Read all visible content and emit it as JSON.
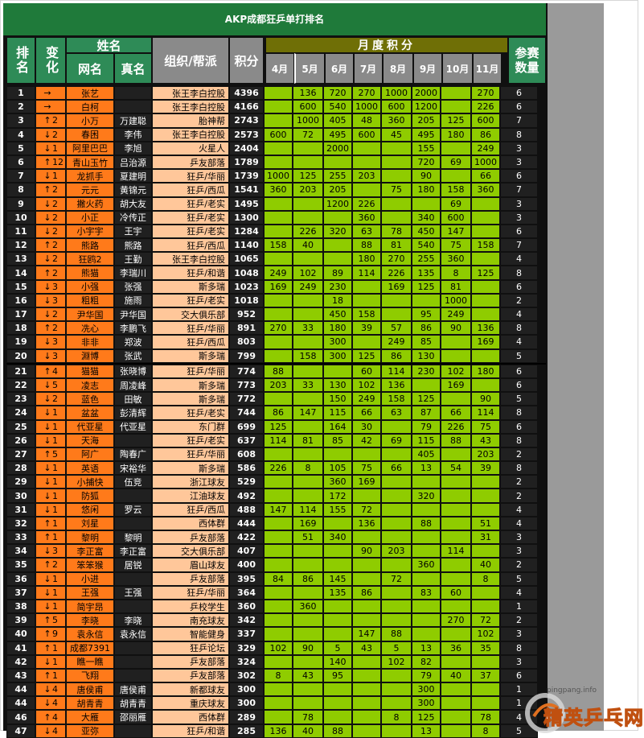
{
  "title": "AKP成都狂乒单打排名",
  "headers": {
    "rank": "排名",
    "change": "变化",
    "name_group": "姓名",
    "netname": "网名",
    "realname": "真名",
    "org": "组织/帮派",
    "score": "积分",
    "monthly": "月度积分",
    "months": [
      "4月",
      "5月",
      "6月",
      "7月",
      "8月",
      "9月",
      "10月",
      "11月"
    ],
    "count": "参赛数量"
  },
  "rows": [
    {
      "rank": "1",
      "dir": "→",
      "chg": "",
      "net": "张艺",
      "real": "",
      "org": "张王李白控股",
      "score": "4396",
      "m": [
        "",
        "136",
        "720",
        "270",
        "1000",
        "2000",
        "",
        "270"
      ],
      "cnt": "6"
    },
    {
      "rank": "2",
      "dir": "→",
      "chg": "",
      "net": "白柯",
      "real": "",
      "org": "张王李白控股",
      "score": "4166",
      "m": [
        "",
        "600",
        "540",
        "1000",
        "600",
        "1200",
        "",
        "226"
      ],
      "cnt": "6"
    },
    {
      "rank": "3",
      "dir": "↑",
      "chg": "2",
      "net": "小万",
      "real": "万建聪",
      "org": "胎神帮",
      "score": "2743",
      "m": [
        "",
        "1000",
        "405",
        "48",
        "360",
        "205",
        "125",
        "600"
      ],
      "cnt": "7"
    },
    {
      "rank": "4",
      "dir": "↓",
      "chg": "2",
      "net": "春困",
      "real": "李伟",
      "org": "张王李白控股",
      "score": "2573",
      "m": [
        "600",
        "72",
        "495",
        "600",
        "45",
        "495",
        "180",
        "86"
      ],
      "cnt": "8"
    },
    {
      "rank": "5",
      "dir": "↓",
      "chg": "1",
      "net": "阿里巴巴",
      "real": "李旭",
      "org": "火星人",
      "score": "2404",
      "m": [
        "",
        "",
        "2000",
        "",
        "",
        "155",
        "",
        "249"
      ],
      "cnt": "3"
    },
    {
      "rank": "6",
      "dir": "↑",
      "chg": "12",
      "net": "青山玉竹",
      "real": "吕治源",
      "org": "乒友部落",
      "score": "1789",
      "m": [
        "",
        "",
        "",
        "",
        "",
        "720",
        "69",
        "1000"
      ],
      "cnt": "3"
    },
    {
      "rank": "7",
      "dir": "↓",
      "chg": "1",
      "net": "龙抓手",
      "real": "夏建明",
      "org": "狂乒/华丽",
      "score": "1739",
      "m": [
        "1000",
        "125",
        "255",
        "203",
        "",
        "90",
        "",
        "66"
      ],
      "cnt": "6"
    },
    {
      "rank": "8",
      "dir": "↑",
      "chg": "2",
      "net": "元元",
      "real": "黄锦元",
      "org": "狂乒/西瓜",
      "score": "1541",
      "m": [
        "360",
        "203",
        "205",
        "",
        "75",
        "180",
        "158",
        "360"
      ],
      "cnt": "7"
    },
    {
      "rank": "9",
      "dir": "↓",
      "chg": "2",
      "net": "撇火药",
      "real": "胡大友",
      "org": "狂乒/老实",
      "score": "1495",
      "m": [
        "",
        "",
        "1200",
        "226",
        "",
        "",
        "69",
        ""
      ],
      "cnt": "3"
    },
    {
      "rank": "10",
      "dir": "↓",
      "chg": "2",
      "net": "小正",
      "real": "冷传正",
      "org": "狂乒/老实",
      "score": "1300",
      "m": [
        "",
        "",
        "",
        "360",
        "",
        "340",
        "600",
        ""
      ],
      "cnt": "3"
    },
    {
      "rank": "11",
      "dir": "↓",
      "chg": "2",
      "net": "小宇宇",
      "real": "王宇",
      "org": "狂乒/老实",
      "score": "1284",
      "m": [
        "",
        "226",
        "320",
        "63",
        "78",
        "450",
        "147",
        ""
      ],
      "cnt": "6"
    },
    {
      "rank": "12",
      "dir": "↑",
      "chg": "2",
      "net": "熊路",
      "real": "熊路",
      "org": "狂乒/西瓜",
      "score": "1140",
      "m": [
        "158",
        "40",
        "",
        "88",
        "81",
        "540",
        "75",
        "158"
      ],
      "cnt": "7"
    },
    {
      "rank": "13",
      "dir": "↓",
      "chg": "2",
      "net": "狂鸥2",
      "real": "王勤",
      "org": "张王李白控股",
      "score": "1065",
      "m": [
        "",
        "",
        "",
        "180",
        "270",
        "255",
        "360",
        ""
      ],
      "cnt": "4"
    },
    {
      "rank": "14",
      "dir": "↑",
      "chg": "2",
      "net": "熊猫",
      "real": "李瑞川",
      "org": "狂乒/和谐",
      "score": "1048",
      "m": [
        "249",
        "102",
        "89",
        "114",
        "226",
        "135",
        "8",
        "125"
      ],
      "cnt": "8"
    },
    {
      "rank": "15",
      "dir": "↓",
      "chg": "3",
      "net": "小强",
      "real": "张强",
      "org": "斯多瑞",
      "score": "1023",
      "m": [
        "169",
        "249",
        "230",
        "",
        "169",
        "125",
        "81",
        ""
      ],
      "cnt": "6"
    },
    {
      "rank": "16",
      "dir": "↓",
      "chg": "3",
      "net": "粗粗",
      "real": "施雨",
      "org": "狂乒/老实",
      "score": "1018",
      "m": [
        "",
        "",
        "18",
        "",
        "",
        "",
        "1000",
        ""
      ],
      "cnt": "2"
    },
    {
      "rank": "17",
      "dir": "↓",
      "chg": "2",
      "net": "尹华国",
      "real": "尹华国",
      "org": "交大俱乐部",
      "score": "952",
      "m": [
        "",
        "",
        "450",
        "158",
        "",
        "95",
        "249",
        ""
      ],
      "cnt": "4"
    },
    {
      "rank": "18",
      "dir": "↑",
      "chg": "2",
      "net": "冼心",
      "real": "李鹏飞",
      "org": "狂乒/华丽",
      "score": "891",
      "m": [
        "270",
        "33",
        "180",
        "39",
        "57",
        "86",
        "90",
        "136"
      ],
      "cnt": "8"
    },
    {
      "rank": "19",
      "dir": "↓",
      "chg": "3",
      "net": "非非",
      "real": "郑波",
      "org": "狂乒/西瓜",
      "score": "803",
      "m": [
        "",
        "",
        "300",
        "",
        "249",
        "85",
        "",
        "169"
      ],
      "cnt": "4"
    },
    {
      "rank": "20",
      "dir": "↓",
      "chg": "3",
      "net": "淵博",
      "real": "张武",
      "org": "斯多瑞",
      "score": "799",
      "m": [
        "",
        "158",
        "300",
        "125",
        "86",
        "130",
        "",
        ""
      ],
      "cnt": "5"
    },
    {
      "rank": "21",
      "dir": "↑",
      "chg": "4",
      "net": "猫猫",
      "real": "张晓博",
      "org": "狂乒/华丽",
      "score": "774",
      "m": [
        "88",
        "",
        "",
        "60",
        "114",
        "230",
        "102",
        "180"
      ],
      "cnt": "6"
    },
    {
      "rank": "22",
      "dir": "↓",
      "chg": "5",
      "net": "凌志",
      "real": "周凌峰",
      "org": "斯多瑞",
      "score": "773",
      "m": [
        "203",
        "33",
        "130",
        "102",
        "136",
        "",
        "169",
        ""
      ],
      "cnt": "6"
    },
    {
      "rank": "23",
      "dir": "↓",
      "chg": "2",
      "net": "蓝色",
      "real": "田敏",
      "org": "斯多瑞",
      "score": "772",
      "m": [
        "",
        "",
        "150",
        "249",
        "158",
        "125",
        "",
        "90"
      ],
      "cnt": "5"
    },
    {
      "rank": "24",
      "dir": "↓",
      "chg": "1",
      "net": "盆盆",
      "real": "彭清辉",
      "org": "狂乒/老实",
      "score": "744",
      "m": [
        "86",
        "147",
        "115",
        "66",
        "63",
        "87",
        "66",
        "114"
      ],
      "cnt": "8"
    },
    {
      "rank": "25",
      "dir": "↓",
      "chg": "1",
      "net": "代亚星",
      "real": "代亚星",
      "org": "东门群",
      "score": "699",
      "m": [
        "125",
        "",
        "164",
        "30",
        "",
        "79",
        "226",
        "75"
      ],
      "cnt": "6"
    },
    {
      "rank": "26",
      "dir": "↓",
      "chg": "1",
      "net": "天海",
      "real": "",
      "org": "狂乒/老实",
      "score": "637",
      "m": [
        "114",
        "81",
        "85",
        "42",
        "69",
        "115",
        "88",
        "43"
      ],
      "cnt": "8"
    },
    {
      "rank": "27",
      "dir": "↑",
      "chg": "5",
      "net": "阿广",
      "real": "陶春广",
      "org": "狂乒/华丽",
      "score": "608",
      "m": [
        "",
        "",
        "",
        "",
        "",
        "405",
        "",
        "203"
      ],
      "cnt": "2"
    },
    {
      "rank": "28",
      "dir": "↓",
      "chg": "1",
      "net": "英语",
      "real": "宋裕华",
      "org": "斯多瑞",
      "score": "586",
      "m": [
        "226",
        "8",
        "105",
        "75",
        "66",
        "13",
        "54",
        "39"
      ],
      "cnt": "8"
    },
    {
      "rank": "29",
      "dir": "↓",
      "chg": "1",
      "net": "小捕快",
      "real": "伍竞",
      "org": "浙江球友",
      "score": "529",
      "m": [
        "",
        "",
        "360",
        "169",
        "",
        "",
        "",
        ""
      ],
      "cnt": "2"
    },
    {
      "rank": "30",
      "dir": "↓",
      "chg": "1",
      "net": "防狐",
      "real": "",
      "org": "江油球友",
      "score": "492",
      "m": [
        "",
        "",
        "172",
        "",
        "",
        "320",
        "",
        ""
      ],
      "cnt": "2"
    },
    {
      "rank": "31",
      "dir": "↓",
      "chg": "1",
      "net": "悠闲",
      "real": "罗云",
      "org": "狂乒/西瓜",
      "score": "488",
      "m": [
        "147",
        "114",
        "155",
        "72",
        "",
        "",
        "",
        ""
      ],
      "cnt": "4"
    },
    {
      "rank": "32",
      "dir": "↑",
      "chg": "1",
      "net": "刘星",
      "real": "",
      "org": "西体群",
      "score": "444",
      "m": [
        "",
        "169",
        "",
        "136",
        "",
        "88",
        "",
        "51"
      ],
      "cnt": "4"
    },
    {
      "rank": "33",
      "dir": "↑",
      "chg": "1",
      "net": "黎明",
      "real": "黎明",
      "org": "乒友部落",
      "score": "422",
      "m": [
        "",
        "51",
        "340",
        "",
        "",
        "",
        "",
        "31"
      ],
      "cnt": "3"
    },
    {
      "rank": "34",
      "dir": "↓",
      "chg": "3",
      "net": "李正富",
      "real": "李正富",
      "org": "交大俱乐部",
      "score": "407",
      "m": [
        "",
        "",
        "",
        "90",
        "203",
        "",
        "114",
        ""
      ],
      "cnt": "3"
    },
    {
      "rank": "35",
      "dir": "↑",
      "chg": "2",
      "net": "笨笨猴",
      "real": "居锐",
      "org": "眉山球友",
      "score": "400",
      "m": [
        "",
        "",
        "",
        "",
        "",
        "360",
        "",
        "40"
      ],
      "cnt": "2"
    },
    {
      "rank": "36",
      "dir": "↓",
      "chg": "1",
      "net": "小进",
      "real": "",
      "org": "乒友部落",
      "score": "395",
      "m": [
        "84",
        "86",
        "145",
        "",
        "72",
        "",
        "",
        "8"
      ],
      "cnt": "5"
    },
    {
      "rank": "37",
      "dir": "↓",
      "chg": "1",
      "net": "王强",
      "real": "王强",
      "org": "狂乒/华丽",
      "score": "364",
      "m": [
        "",
        "",
        "135",
        "86",
        "",
        "83",
        "60",
        ""
      ],
      "cnt": "4"
    },
    {
      "rank": "38",
      "dir": "↓",
      "chg": "1",
      "net": "简宇昂",
      "real": "",
      "org": "乒校学生",
      "score": "360",
      "m": [
        "",
        "360",
        "",
        "",
        "",
        "",
        "",
        ""
      ],
      "cnt": "1"
    },
    {
      "rank": "39",
      "dir": "↑",
      "chg": "5",
      "net": "李晓",
      "real": "李晓",
      "org": "南充球友",
      "score": "342",
      "m": [
        "",
        "",
        "",
        "",
        "",
        "",
        "270",
        "72"
      ],
      "cnt": "2"
    },
    {
      "rank": "40",
      "dir": "↑",
      "chg": "9",
      "net": "袁永信",
      "real": "袁永信",
      "org": "智能健身",
      "score": "337",
      "m": [
        "",
        "",
        "",
        "147",
        "88",
        "",
        "",
        "102"
      ],
      "cnt": "3"
    },
    {
      "rank": "41",
      "dir": "↑",
      "chg": "1",
      "net": "成都7391",
      "real": "",
      "org": "狂乒论坛",
      "score": "329",
      "m": [
        "102",
        "90",
        "5",
        "43",
        "5",
        "13",
        "36",
        "35"
      ],
      "cnt": "8"
    },
    {
      "rank": "42",
      "dir": "↓",
      "chg": "1",
      "net": "瞧一瞧",
      "real": "",
      "org": "乒友部落",
      "score": "324",
      "m": [
        "",
        "",
        "140",
        "",
        "102",
        "82",
        "",
        ""
      ],
      "cnt": "3"
    },
    {
      "rank": "43",
      "dir": "↑",
      "chg": "1",
      "net": "飞翔",
      "real": "",
      "org": "乒友部落",
      "score": "302",
      "m": [
        "8",
        "43",
        "95",
        "",
        "",
        "79",
        "40",
        "37"
      ],
      "cnt": "6"
    },
    {
      "rank": "44",
      "dir": "↓",
      "chg": "4",
      "net": "唐侯甫",
      "real": "唐侯甫",
      "org": "新都球友",
      "score": "300",
      "m": [
        "",
        "",
        "",
        "",
        "",
        "300",
        "",
        ""
      ],
      "cnt": "1"
    },
    {
      "rank": "44",
      "dir": "↓",
      "chg": "4",
      "net": "胡青青",
      "real": "胡青青",
      "org": "重庆球友",
      "score": "300",
      "m": [
        "",
        "",
        "",
        "",
        "",
        "300",
        "",
        ""
      ],
      "cnt": "1"
    },
    {
      "rank": "46",
      "dir": "↑",
      "chg": "4",
      "net": "大雁",
      "real": "邵丽雁",
      "org": "西体群",
      "score": "289",
      "m": [
        "",
        "78",
        "",
        "",
        "8",
        "125",
        "",
        "78"
      ],
      "cnt": "4"
    },
    {
      "rank": "47",
      "dir": "↓",
      "chg": "4",
      "net": "亚弥",
      "real": "",
      "org": "狂乒/和谐",
      "score": "285",
      "m": [
        "136",
        "40",
        "88",
        "",
        "",
        "13",
        "",
        "8"
      ],
      "cnt": "5"
    }
  ],
  "watermark": {
    "url": "pingpang.info",
    "brand": "精英乒乓网"
  },
  "colors": {
    "header_green": "#2e8b57",
    "orange": "#ff7a1a",
    "peach": "#ffc79a",
    "lime": "#8fcc00",
    "olive": "#6f6f06"
  }
}
